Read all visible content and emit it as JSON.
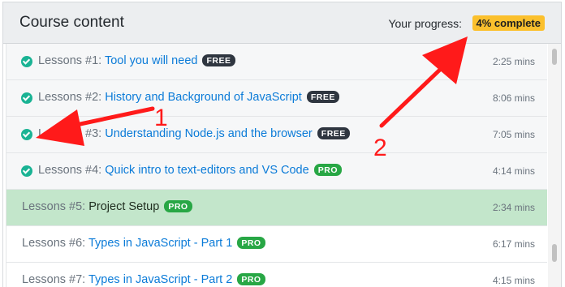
{
  "header": {
    "title": "Course content",
    "progress_label": "Your progress:",
    "progress_badge": "4% complete"
  },
  "progress_fraction": 0.04,
  "colors": {
    "accent_link": "#0b7bd8",
    "completed_check": "#1ab394",
    "badge_free": "#2f3640",
    "badge_pro": "#28a745",
    "progress_badge": "#fbc02d",
    "active_row": "#c3e6cb",
    "annotation_arrow": "#ff1a1a"
  },
  "lessons": [
    {
      "prefix": "Lessons #1:",
      "title": "Tool you will need",
      "badge": "FREE",
      "duration": "2:25 mins",
      "completed": true
    },
    {
      "prefix": "Lessons #2:",
      "title": "History and Background of JavaScript",
      "badge": "FREE",
      "duration": "8:06 mins",
      "completed": true
    },
    {
      "prefix": "Lessons #3:",
      "title": "Understanding Node.js and the browser",
      "badge": "FREE",
      "duration": "7:05 mins",
      "completed": true
    },
    {
      "prefix": "Lessons #4:",
      "title": "Quick intro to text-editors and VS Code",
      "badge": "PRO",
      "duration": "4:14 mins",
      "completed": true
    },
    {
      "prefix": "Lessons #5:",
      "title": "Project Setup",
      "badge": "PRO",
      "duration": "2:34 mins",
      "completed": false,
      "active": true
    },
    {
      "prefix": "Lessons #6:",
      "title": "Types in JavaScript - Part 1",
      "badge": "PRO",
      "duration": "6:17 mins",
      "completed": false
    },
    {
      "prefix": "Lessons #7:",
      "title": "Types in JavaScript - Part 2",
      "badge": "PRO",
      "duration": "4:15 mins",
      "completed": false
    }
  ],
  "annotations": [
    {
      "label": "1",
      "icon": "red-arrow-icon"
    },
    {
      "label": "2",
      "icon": "red-arrow-icon"
    }
  ]
}
